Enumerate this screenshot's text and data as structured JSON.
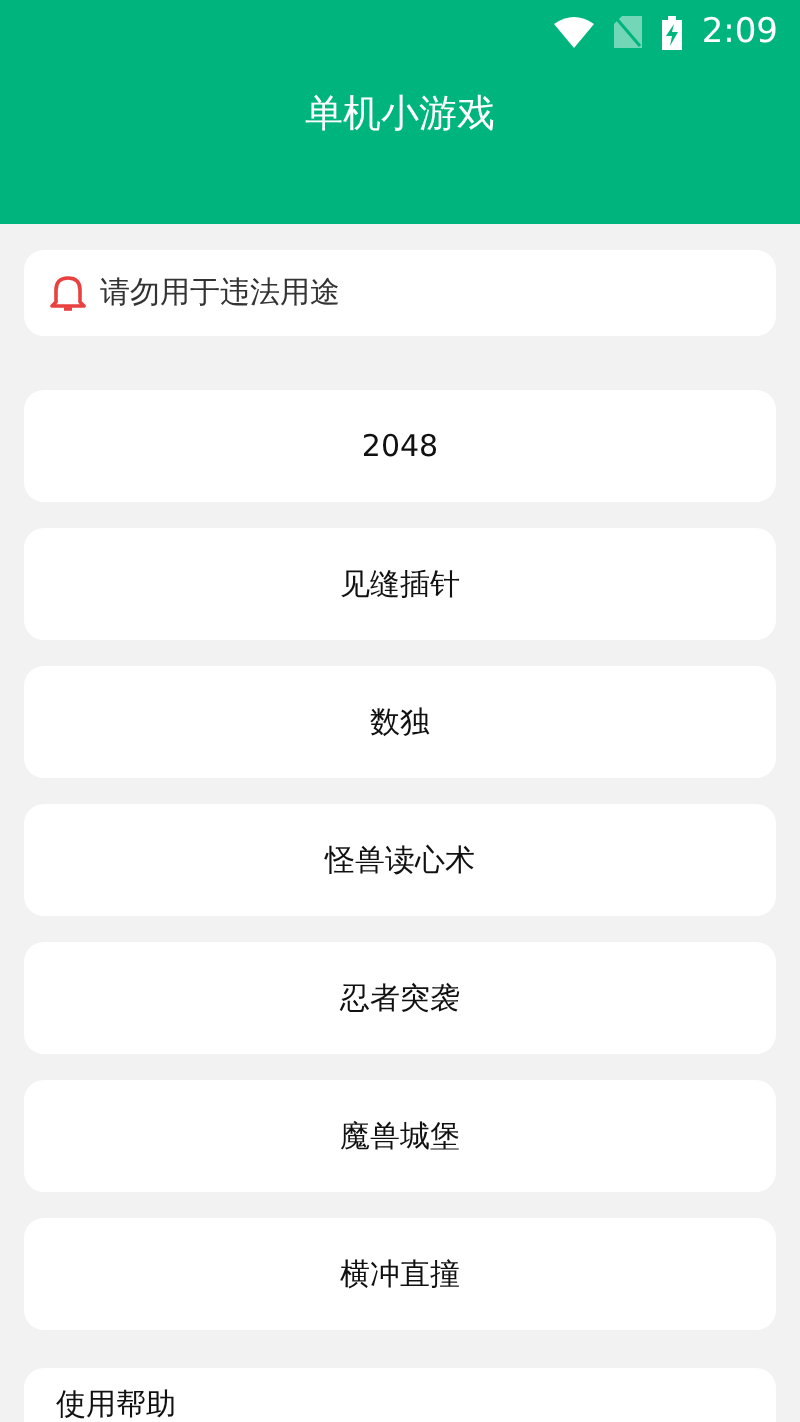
{
  "status_bar": {
    "time": "2:09"
  },
  "header": {
    "title": "单机小游戏"
  },
  "notice": {
    "text": "请勿用于违法用途"
  },
  "games": [
    {
      "label": "2048"
    },
    {
      "label": "见缝插针"
    },
    {
      "label": "数独"
    },
    {
      "label": "怪兽读心术"
    },
    {
      "label": "忍者突袭"
    },
    {
      "label": "魔兽城堡"
    },
    {
      "label": "横冲直撞"
    }
  ],
  "help": {
    "title": "使用帮助"
  }
}
